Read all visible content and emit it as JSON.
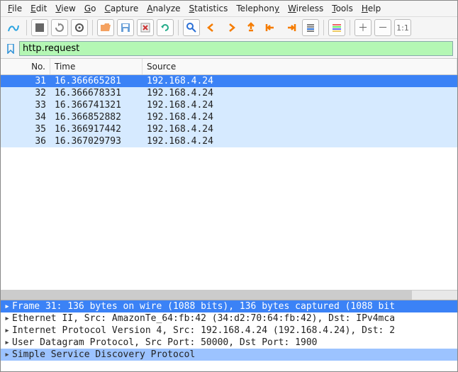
{
  "menu": {
    "items": [
      {
        "hotkey": "F",
        "rest": "ile"
      },
      {
        "hotkey": "E",
        "rest": "dit"
      },
      {
        "hotkey": "V",
        "rest": "iew"
      },
      {
        "hotkey": "G",
        "rest": "o"
      },
      {
        "hotkey": "C",
        "rest": "apture"
      },
      {
        "hotkey": "A",
        "rest": "nalyze"
      },
      {
        "hotkey": "S",
        "rest": "tatistics"
      },
      {
        "hotkey": "",
        "rest": "Telephon",
        "hotkey2": "y"
      },
      {
        "hotkey": "W",
        "rest": "ireless"
      },
      {
        "hotkey": "T",
        "rest": "ools"
      },
      {
        "hotkey": "H",
        "rest": "elp"
      }
    ]
  },
  "filter": {
    "value": "http.request"
  },
  "packet_list": {
    "columns": {
      "no": "No.",
      "time": "Time",
      "source": "Source"
    },
    "rows": [
      {
        "no": "31",
        "time": "16.366665281",
        "source": "192.168.4.24",
        "selected": true
      },
      {
        "no": "32",
        "time": "16.366678331",
        "source": "192.168.4.24",
        "selected": false
      },
      {
        "no": "33",
        "time": "16.366741321",
        "source": "192.168.4.24",
        "selected": false
      },
      {
        "no": "34",
        "time": "16.366852882",
        "source": "192.168.4.24",
        "selected": false
      },
      {
        "no": "35",
        "time": "16.366917442",
        "source": "192.168.4.24",
        "selected": false
      },
      {
        "no": "36",
        "time": "16.367029793",
        "source": "192.168.4.24",
        "selected": false
      }
    ]
  },
  "details": {
    "rows": [
      {
        "text": "Frame 31: 136 bytes on wire (1088 bits), 136 bytes captured (1088 bit",
        "state": "selected"
      },
      {
        "text": "Ethernet II, Src: AmazonTe_64:fb:42 (34:d2:70:64:fb:42), Dst: IPv4mca",
        "state": ""
      },
      {
        "text": "Internet Protocol Version 4, Src: 192.168.4.24 (192.168.4.24), Dst: 2",
        "state": ""
      },
      {
        "text": "User Datagram Protocol, Src Port: 50000, Dst Port: 1900",
        "state": ""
      },
      {
        "text": "Simple Service Discovery Protocol",
        "state": "focus2"
      }
    ]
  },
  "icons": {
    "arrow_right": "▸"
  }
}
